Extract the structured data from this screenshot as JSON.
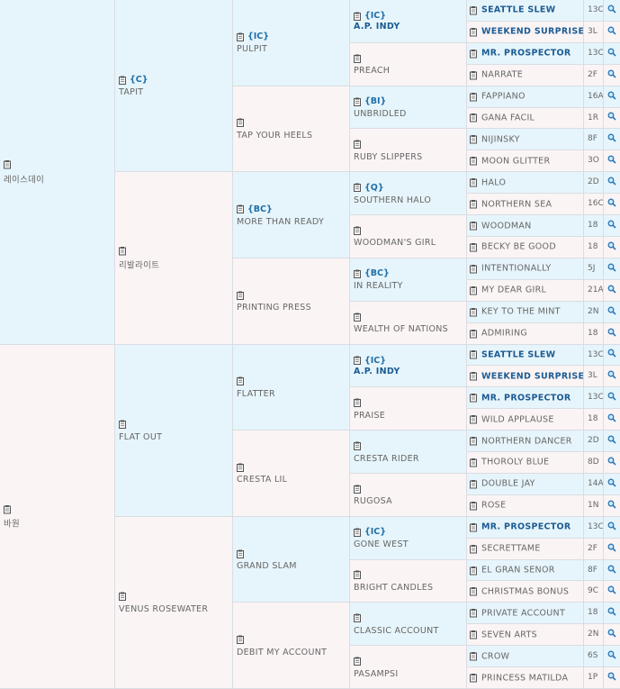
{
  "pedigree": {
    "gen1": [
      {
        "name": "레이스데이",
        "code": "",
        "sex": "m"
      },
      {
        "name": "바원",
        "code": "",
        "sex": "f"
      }
    ],
    "gen2": [
      {
        "name": "TAPIT",
        "code": "{C}",
        "sex": "m"
      },
      {
        "name": "리발라이트",
        "code": "",
        "sex": "f"
      },
      {
        "name": "FLAT OUT",
        "code": "",
        "sex": "m"
      },
      {
        "name": "VENUS ROSEWATER",
        "code": "",
        "sex": "f"
      }
    ],
    "gen3": [
      {
        "name": "PULPIT",
        "code": "{IC}",
        "sex": "m"
      },
      {
        "name": "TAP YOUR HEELS",
        "code": "",
        "sex": "f"
      },
      {
        "name": "MORE THAN READY",
        "code": "{BC}",
        "sex": "m"
      },
      {
        "name": "PRINTING PRESS",
        "code": "",
        "sex": "f"
      },
      {
        "name": "FLATTER",
        "code": "",
        "sex": "m"
      },
      {
        "name": "CRESTA LIL",
        "code": "",
        "sex": "f"
      },
      {
        "name": "GRAND SLAM",
        "code": "",
        "sex": "m"
      },
      {
        "name": "DEBIT MY ACCOUNT",
        "code": "",
        "sex": "f"
      }
    ],
    "gen4": [
      {
        "name": "A.P. INDY",
        "code": "{IC}",
        "sex": "m",
        "bold": true
      },
      {
        "name": "PREACH",
        "code": "",
        "sex": "f"
      },
      {
        "name": "UNBRIDLED",
        "code": "{BI}",
        "sex": "m"
      },
      {
        "name": "RUBY SLIPPERS",
        "code": "",
        "sex": "f"
      },
      {
        "name": "SOUTHERN HALO",
        "code": "{Q}",
        "sex": "m"
      },
      {
        "name": "WOODMAN'S GIRL",
        "code": "",
        "sex": "f"
      },
      {
        "name": "IN REALITY",
        "code": "{BC}",
        "sex": "m"
      },
      {
        "name": "WEALTH OF NATIONS",
        "code": "",
        "sex": "f"
      },
      {
        "name": "A.P. INDY",
        "code": "{IC}",
        "sex": "m",
        "bold": true
      },
      {
        "name": "PRAISE",
        "code": "",
        "sex": "f"
      },
      {
        "name": "CRESTA RIDER",
        "code": "",
        "sex": "m"
      },
      {
        "name": "RUGOSA",
        "code": "",
        "sex": "f"
      },
      {
        "name": "GONE WEST",
        "code": "{IC}",
        "sex": "m"
      },
      {
        "name": "BRIGHT CANDLES",
        "code": "",
        "sex": "f"
      },
      {
        "name": "CLASSIC ACCOUNT",
        "code": "",
        "sex": "m"
      },
      {
        "name": "PASAMPSI",
        "code": "",
        "sex": "f"
      }
    ],
    "gen5": [
      {
        "name": "SEATTLE SLEW",
        "stat": "13C",
        "bold": true
      },
      {
        "name": "WEEKEND SURPRISE",
        "stat": "3L",
        "bold": true
      },
      {
        "name": "MR. PROSPECTOR",
        "stat": "13C",
        "bold": true
      },
      {
        "name": "NARRATE",
        "stat": "2F"
      },
      {
        "name": "FAPPIANO",
        "stat": "16A"
      },
      {
        "name": "GANA FACIL",
        "stat": "1R"
      },
      {
        "name": "NIJINSKY",
        "stat": "8F"
      },
      {
        "name": "MOON GLITTER",
        "stat": "3O"
      },
      {
        "name": "HALO",
        "stat": "2D"
      },
      {
        "name": "NORTHERN SEA",
        "stat": "16C"
      },
      {
        "name": "WOODMAN",
        "stat": "18"
      },
      {
        "name": "BECKY BE GOOD",
        "stat": "18"
      },
      {
        "name": "INTENTIONALLY",
        "stat": "5J"
      },
      {
        "name": "MY DEAR GIRL",
        "stat": "21A"
      },
      {
        "name": "KEY TO THE MINT",
        "stat": "2N"
      },
      {
        "name": "ADMIRING",
        "stat": "18"
      },
      {
        "name": "SEATTLE SLEW",
        "stat": "13C",
        "bold": true
      },
      {
        "name": "WEEKEND SURPRISE",
        "stat": "3L",
        "bold": true
      },
      {
        "name": "MR. PROSPECTOR",
        "stat": "13C",
        "bold": true
      },
      {
        "name": "WILD APPLAUSE",
        "stat": "18"
      },
      {
        "name": "NORTHERN DANCER",
        "stat": "2D"
      },
      {
        "name": "THOROLY BLUE",
        "stat": "8D"
      },
      {
        "name": "DOUBLE JAY",
        "stat": "14A"
      },
      {
        "name": "ROSE",
        "stat": "1N"
      },
      {
        "name": "MR. PROSPECTOR",
        "stat": "13C",
        "bold": true
      },
      {
        "name": "SECRETTAME",
        "stat": "2F"
      },
      {
        "name": "EL GRAN SENOR",
        "stat": "8F"
      },
      {
        "name": "CHRISTMAS BONUS",
        "stat": "9C"
      },
      {
        "name": "PRIVATE ACCOUNT",
        "stat": "18"
      },
      {
        "name": "SEVEN ARTS",
        "stat": "2N"
      },
      {
        "name": "CROW",
        "stat": "6S"
      },
      {
        "name": "PRINCESS MATILDA",
        "stat": "1P"
      }
    ]
  },
  "colors": {
    "male_bg": "#e6f5fb",
    "female_bg": "#fbf4f5",
    "link": "#1c5b92",
    "code": "#1f6ea8"
  }
}
